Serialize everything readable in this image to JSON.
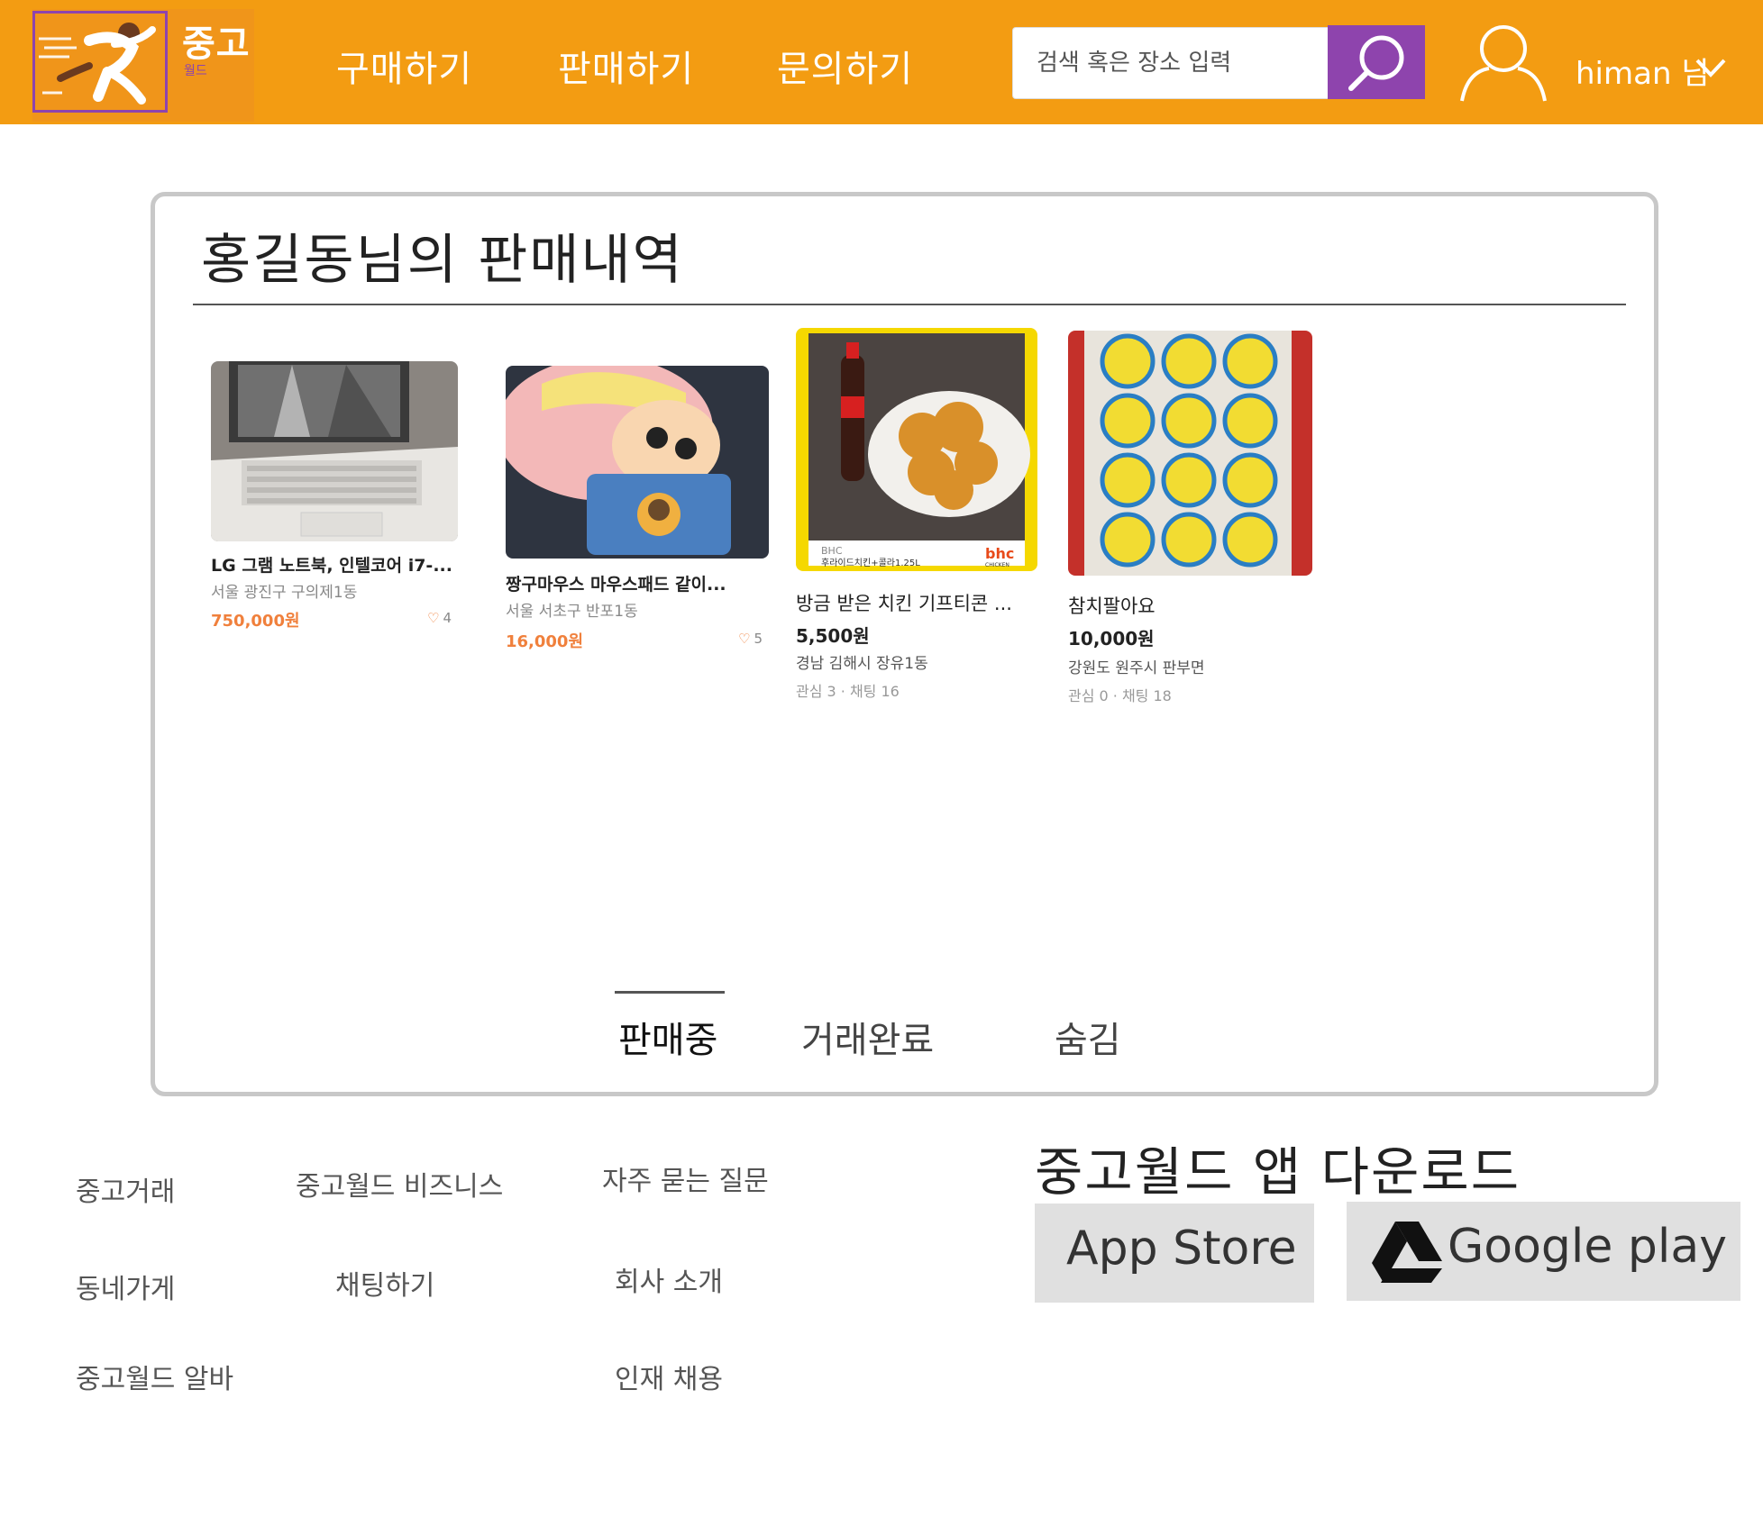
{
  "header": {
    "logo_title": "중고",
    "logo_sub": "월드",
    "nav": [
      "구매하기",
      "판매하기",
      "문의하기"
    ],
    "search_placeholder": "검색 혹은 장소 입력",
    "username": "himan 님"
  },
  "page": {
    "title": "홍길동님의 판매내역"
  },
  "products": [
    {
      "title": "LG 그램 노트북, 인텔코어 i7-...",
      "location": "서울 광진구 구의제1동",
      "price": "750,000원",
      "likes": "4"
    },
    {
      "title": "짱구마우스 마우스패드 같이...",
      "location": "서울 서초구 반포1동",
      "price": "16,000원",
      "likes": "5"
    },
    {
      "title": "방금 받은 치킨 기프티콘 ...",
      "price": "5,500원",
      "location": "경남 김해시 장유1동",
      "meta": "관심 3 · 채팅 16",
      "image_text": {
        "brand": "BHC",
        "product": "후라이드치킨+콜라1.25L",
        "logo": "bhc",
        "logo_sub": "CHICKEN"
      }
    },
    {
      "title": "참치팔아요",
      "price": "10,000원",
      "location": "강원도 원주시 판부면",
      "meta": "관심 0 · 채팅 18"
    }
  ],
  "tabs": [
    "판매중",
    "거래완료",
    "숨김"
  ],
  "footer": {
    "col1": [
      "중고거래",
      "동네가게",
      "중고월드 알바"
    ],
    "col2": [
      "중고월드 비즈니스",
      "채팅하기"
    ],
    "col3": [
      "자주 묻는 질문",
      "회사 소개",
      "인재 채용"
    ],
    "app_heading": "중고월드 앱 다운로드",
    "app_store": "App Store",
    "google_play": "Google play"
  },
  "colors": {
    "header_bg": "#f39c12",
    "accent_purple": "#8e44ad",
    "price_orange": "#f0803c"
  },
  "icons": [
    "runner-logo-icon",
    "search-icon",
    "user-icon",
    "chevron-down-icon",
    "heart-icon",
    "google-drive-icon"
  ]
}
